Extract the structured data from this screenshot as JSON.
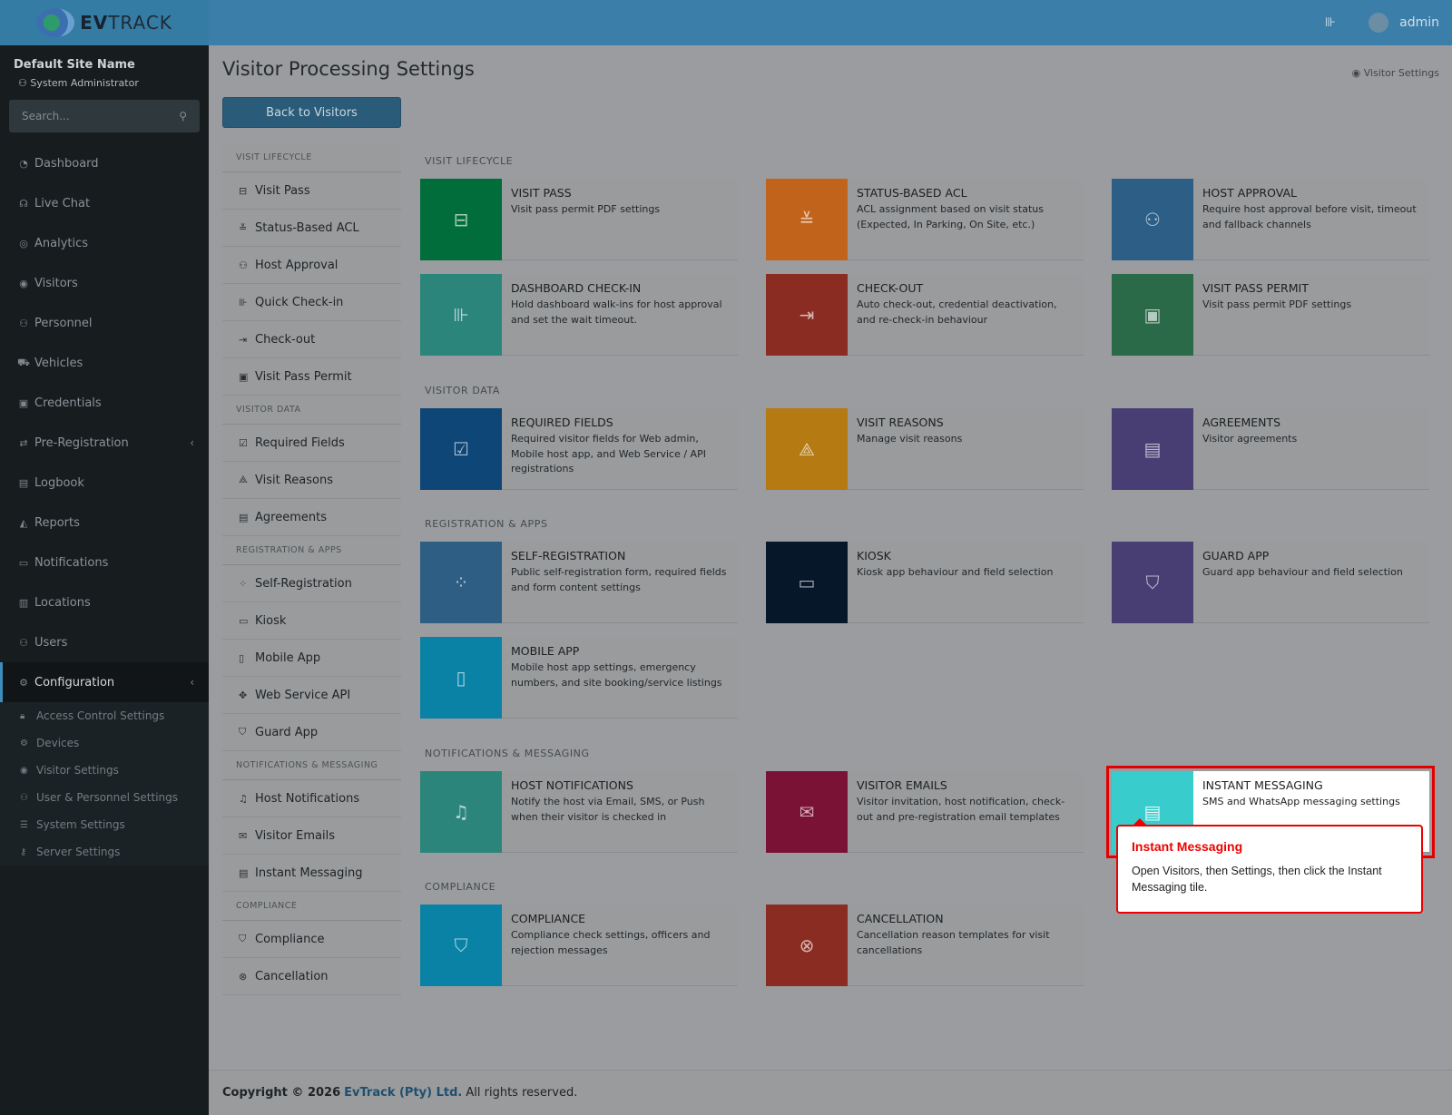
{
  "brand": {
    "logo_text_a": "EV",
    "logo_text_b": "TRACK"
  },
  "topbar": {
    "user": "admin"
  },
  "sidebar": {
    "site": "Default Site Name",
    "role": "System Administrator",
    "search_placeholder": "Search...",
    "items": [
      {
        "label": "Dashboard",
        "icon": "dashboard-icon"
      },
      {
        "label": "Live Chat",
        "icon": "headset-icon"
      },
      {
        "label": "Analytics",
        "icon": "target-icon"
      },
      {
        "label": "Visitors",
        "icon": "eye-icon"
      },
      {
        "label": "Personnel",
        "icon": "users-icon"
      },
      {
        "label": "Vehicles",
        "icon": "car-icon"
      },
      {
        "label": "Credentials",
        "icon": "id-card-icon"
      },
      {
        "label": "Pre-Registration",
        "icon": "swap-icon"
      },
      {
        "label": "Logbook",
        "icon": "book-icon"
      },
      {
        "label": "Reports",
        "icon": "chart-icon"
      },
      {
        "label": "Notifications",
        "icon": "chat-icon"
      },
      {
        "label": "Locations",
        "icon": "map-icon"
      },
      {
        "label": "Users",
        "icon": "user-icon"
      },
      {
        "label": "Configuration",
        "icon": "gear-icon"
      }
    ],
    "sub": [
      {
        "label": "Access Control Settings",
        "icon": "lock-icon"
      },
      {
        "label": "Devices",
        "icon": "cog-icon"
      },
      {
        "label": "Visitor Settings",
        "icon": "eye-icon"
      },
      {
        "label": "User & Personnel Settings",
        "icon": "user-cog-icon"
      },
      {
        "label": "System Settings",
        "icon": "sliders-icon"
      },
      {
        "label": "Server Settings",
        "icon": "key-icon"
      }
    ]
  },
  "page": {
    "title": "Visitor Processing Settings",
    "crumb": "Visitor Settings",
    "back": "Back to Visitors"
  },
  "leftmenu": {
    "sections": [
      {
        "title": "VISIT LIFECYCLE",
        "items": [
          "Visit Pass",
          "Status-Based ACL",
          "Host Approval",
          "Quick Check-in",
          "Check-out",
          "Visit Pass Permit"
        ]
      },
      {
        "title": "VISITOR DATA",
        "items": [
          "Required Fields",
          "Visit Reasons",
          "Agreements"
        ]
      },
      {
        "title": "REGISTRATION & APPS",
        "items": [
          "Self-Registration",
          "Kiosk",
          "Mobile App",
          "Web Service API",
          "Guard App"
        ]
      },
      {
        "title": "NOTIFICATIONS & MESSAGING",
        "items": [
          "Host Notifications",
          "Visitor Emails",
          "Instant Messaging"
        ]
      },
      {
        "title": "COMPLIANCE",
        "items": [
          "Compliance",
          "Cancellation"
        ]
      }
    ]
  },
  "tiles": {
    "sec1": "VISIT LIFECYCLE",
    "sec2": "VISITOR DATA",
    "sec3": "REGISTRATION & APPS",
    "sec4": "NOTIFICATIONS & MESSAGING",
    "sec5": "COMPLIANCE",
    "visit_pass": {
      "name": "VISIT PASS",
      "desc": "Visit pass permit PDF settings",
      "color": "#006d3a"
    },
    "status_acl": {
      "name": "STATUS-BASED ACL",
      "desc": "ACL assignment based on visit status (Expected, In Parking, On Site, etc.)",
      "color": "#c1631a"
    },
    "host_approval": {
      "name": "HOST APPROVAL",
      "desc": "Require host approval before visit, timeout and fallback channels",
      "color": "#2d5f86"
    },
    "dash_checkin": {
      "name": "DASHBOARD CHECK-IN",
      "desc": "Hold dashboard walk-ins for host approval and set the wait timeout.",
      "color": "#2c857b"
    },
    "checkout": {
      "name": "CHECK-OUT",
      "desc": "Auto check-out, credential deactivation, and re-check-in behaviour",
      "color": "#8a2c22"
    },
    "permit": {
      "name": "VISIT PASS PERMIT",
      "desc": "Visit pass permit PDF settings",
      "color": "#2a6a48"
    },
    "required": {
      "name": "REQUIRED FIELDS",
      "desc": "Required visitor fields for Web admin, Mobile host app, and Web Service / API registrations",
      "color": "#0d4677"
    },
    "reasons": {
      "name": "VISIT REASONS",
      "desc": "Manage visit reasons",
      "color": "#b57a12"
    },
    "agreements": {
      "name": "AGREEMENTS",
      "desc": "Visitor agreements",
      "color": "#483e73"
    },
    "selfreg": {
      "name": "SELF-REGISTRATION",
      "desc": "Public self-registration form, required fields and form content settings",
      "color": "#2e5e84"
    },
    "kiosk": {
      "name": "KIOSK",
      "desc": "Kiosk app behaviour and field selection",
      "color": "#06172a"
    },
    "guard": {
      "name": "GUARD APP",
      "desc": "Guard app behaviour and field selection",
      "color": "#483e73"
    },
    "mobile": {
      "name": "MOBILE APP",
      "desc": "Mobile host app settings, emergency numbers, and site booking/service listings",
      "color": "#0982a6"
    },
    "hostnotif": {
      "name": "HOST NOTIFICATIONS",
      "desc": "Notify the host via Email, SMS, or Push when their visitor is checked in",
      "color": "#2c857b"
    },
    "emails": {
      "name": "VISITOR EMAILS",
      "desc": "Visitor invitation, host notification, check-out and pre-registration email templates",
      "color": "#7a1236"
    },
    "im": {
      "name": "INSTANT MESSAGING",
      "desc": "SMS and WhatsApp messaging settings",
      "color": "#39cccc"
    },
    "compliance": {
      "name": "COMPLIANCE",
      "desc": "Compliance check settings, officers and rejection messages",
      "color": "#0982a6"
    },
    "cancel": {
      "name": "CANCELLATION",
      "desc": "Cancellation reason templates for visit cancellations",
      "color": "#8a2c22"
    }
  },
  "tooltip": {
    "title": "Instant Messaging",
    "text": "Open Visitors, then Settings, then click the Instant Messaging tile."
  },
  "footer": {
    "copy": "Copyright © 2026",
    "company": "EvTrack (Pty) Ltd.",
    "rights": "All rights reserved."
  }
}
